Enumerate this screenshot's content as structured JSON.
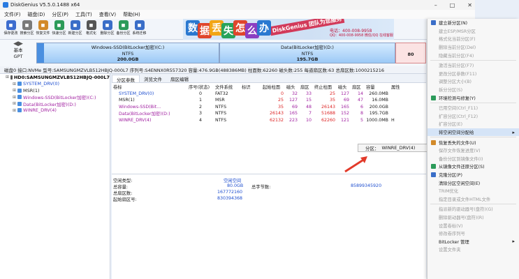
{
  "window": {
    "title": "DiskGenius V5.5.0.1488 x64"
  },
  "menu": [
    "文件(F)",
    "磁盘(D)",
    "分区(P)",
    "工具(T)",
    "查看(V)",
    "帮助(H)"
  ],
  "toolbar": [
    {
      "label": "保存更改",
      "icon": "save-icon",
      "color": "#3c6ccf"
    },
    {
      "label": "搜索分区",
      "icon": "search-icon",
      "color": "#7a7a7a"
    },
    {
      "label": "恢复文件",
      "icon": "recover-files-icon",
      "color": "#d28a2a"
    },
    {
      "label": "快速分区",
      "icon": "quick-partition-icon",
      "color": "#2c9b5a"
    },
    {
      "label": "新建分区",
      "icon": "new-partition-icon",
      "color": "#3a6ec8"
    },
    {
      "label": "格式化",
      "icon": "format-icon",
      "color": "#555555"
    },
    {
      "label": "删除分区",
      "icon": "delete-partition-icon",
      "color": "#3a6ec8"
    },
    {
      "label": "备份分区",
      "icon": "backup-partition-icon",
      "color": "#2c9b5a"
    },
    {
      "label": "系统迁移",
      "icon": "system-migrate-icon",
      "color": "#3a6ec8"
    }
  ],
  "banner": {
    "chars": [
      "数",
      "据",
      "丢",
      "失",
      "怎",
      "么",
      "办"
    ],
    "char_colors": [
      "#2a78d0",
      "#e0452c",
      "#f2a515",
      "#27a35b",
      "#e0452c",
      "#8b3ec2",
      "#2a78d0"
    ],
    "slogan": "DiskGenius 团队为您服务",
    "phone": "电话：400-008-9958",
    "qq": "QQ：400-008-9958 微信/QQ 在线客服"
  },
  "disk": {
    "type": "基本",
    "style": "GPT",
    "parts": [
      {
        "name": "Windows-SSD(BitLocker加密)(C:)",
        "fs": "NTFS",
        "size": "200.0GB"
      },
      {
        "name": "Data(BitLocker加密)(D:)",
        "fs": "NTFS",
        "size": "195.7GB"
      },
      {
        "name": "",
        "fs": "",
        "size": "80"
      }
    ]
  },
  "status_line": "磁盘0 接口:NVMe 型号:SAMSUNGMZVLB512HBJQ-000L7 序列号:S4ENNX0R557320 容量:476.9GB(488386MB) 柱面数:62260 磁头数:255 每道扇区数:63 总扇区数:1000215216",
  "tree": [
    {
      "label": "HD0:SAMSUNGMZVLB512HBJQ-000L7",
      "color": "#000",
      "selected": false,
      "icon": "disk-icon"
    },
    {
      "label": "SYSTEM_DRV(0)",
      "color": "#1e4ecf",
      "selected": false,
      "icon": "partition-icon"
    },
    {
      "label": "MSR(1)",
      "color": "#1a1a1a",
      "selected": false,
      "icon": "partition-icon"
    },
    {
      "label": "Windows-SSD(BitLocker加密)(C:)",
      "color": "#a01fa0",
      "selected": false,
      "icon": "partition-icon"
    },
    {
      "label": "Data(BitLocker加密)(D:)",
      "color": "#a01fa0",
      "selected": false,
      "icon": "partition-icon"
    },
    {
      "label": "WINRE_DRV(4)",
      "color": "#a01fa0",
      "selected": false,
      "icon": "partition-icon"
    }
  ],
  "tabs": [
    "分区参数",
    "浏览文件",
    "扇区编辑"
  ],
  "table": {
    "headers": [
      "卷标",
      "序号(状态)",
      "文件系统",
      "标识",
      "起始柱面",
      "磁头",
      "扇区",
      "终止柱面",
      "磁头",
      "扇区",
      "容量",
      "属性"
    ],
    "rows": [
      {
        "cells": [
          "SYSTEM_DRV(0)",
          "0",
          "FAT32",
          "",
          "0",
          "32",
          "33",
          "25",
          "127",
          "14",
          "260.0MB",
          ""
        ],
        "color": "#1e4ecf"
      },
      {
        "cells": [
          "MSR(1)",
          "1",
          "MSR",
          "",
          "25",
          "127",
          "15",
          "35",
          "69",
          "47",
          "16.0MB",
          ""
        ],
        "color": "#1a1a1a"
      },
      {
        "cells": [
          "Windows-SSD(Bit...",
          "2",
          "NTFS",
          "",
          "35",
          "69",
          "48",
          "26143",
          "165",
          "6",
          "200.0GB",
          ""
        ],
        "color": "#a01fa0"
      },
      {
        "cells": [
          "Data(BitLocker加密)(D:)",
          "3",
          "NTFS",
          "",
          "26143",
          "165",
          "7",
          "51688",
          "152",
          "8",
          "195.7GB",
          ""
        ],
        "color": "#a01fa0"
      },
      {
        "cells": [
          "WINRE_DRV(4)",
          "4",
          "NTFS",
          "",
          "62132",
          "223",
          "10",
          "62260",
          "121",
          "5",
          "1000.0MB",
          "H"
        ],
        "color": "#a01fa0"
      }
    ]
  },
  "free": {
    "type_label": "空闲类型:",
    "type_value": "空闲空间",
    "total_label": "总容量:",
    "total_value": "80.0GB",
    "total_bytes_label": "总字节数:",
    "total_bytes_value": "85899345920",
    "sectors_label": "总扇区数:",
    "sectors_value": "167772160",
    "start_label": "起始扇区号:",
    "start_value": "830394368"
  },
  "callout": {
    "label": "分区：",
    "value": "WINRE_DRV(4)"
  },
  "context_menu": [
    {
      "label": "建立新分区(N)",
      "disabled": false,
      "icon": "#3a6ec8",
      "highlight": false,
      "sub": false
    },
    {
      "label": "建立ESP/MSR分区",
      "disabled": true,
      "icon": "",
      "highlight": false,
      "sub": false
    },
    {
      "label": "格式化当前分区(F)",
      "disabled": true,
      "icon": "",
      "highlight": false,
      "sub": false
    },
    {
      "label": "删除当前分区(Del)",
      "disabled": true,
      "icon": "",
      "highlight": false,
      "sub": false
    },
    {
      "label": "隐藏当前分区(F4)",
      "disabled": true,
      "icon": "",
      "highlight": false,
      "sub": false
    },
    {
      "label": "",
      "divider": true
    },
    {
      "label": "激活当前分区(F7)",
      "disabled": true,
      "icon": "",
      "highlight": false,
      "sub": false
    },
    {
      "label": "更改分区参数(F11)",
      "disabled": true,
      "icon": "",
      "highlight": false,
      "sub": false
    },
    {
      "label": "调整分区大小(B)",
      "disabled": true,
      "icon": "",
      "highlight": false,
      "sub": false
    },
    {
      "label": "拆分分区(S)",
      "disabled": true,
      "icon": "",
      "highlight": false,
      "sub": false
    },
    {
      "label": "环境检测与修复(Y)",
      "disabled": false,
      "icon": "#2c9b5a",
      "highlight": false,
      "sub": false
    },
    {
      "label": "",
      "divider": true
    },
    {
      "label": "已用空间(Ctrl_F11)",
      "disabled": true,
      "icon": "",
      "highlight": false,
      "sub": false
    },
    {
      "label": "扩容分区(Ctrl_F12)",
      "disabled": true,
      "icon": "",
      "highlight": false,
      "sub": false
    },
    {
      "label": "扩容分区(E)",
      "disabled": true,
      "icon": "",
      "highlight": false,
      "sub": false
    },
    {
      "label": "将空闲空间分配给",
      "disabled": false,
      "icon": "",
      "highlight": true,
      "sub": true
    },
    {
      "label": "",
      "divider": true
    },
    {
      "label": "恢复丢失的文件(U)",
      "disabled": false,
      "icon": "#d28a2a",
      "highlight": false,
      "sub": false
    },
    {
      "label": "保存文件恢复进度(V)",
      "disabled": true,
      "icon": "",
      "highlight": false,
      "sub": false
    },
    {
      "label": "备份分区到镜像文件(I)",
      "disabled": true,
      "icon": "",
      "highlight": false,
      "sub": false
    },
    {
      "label": "从镜像文件还原分区(S)",
      "disabled": false,
      "icon": "#2c9b5a",
      "highlight": false,
      "sub": false
    },
    {
      "label": "克隆分区(P)",
      "disabled": false,
      "icon": "#3a6ec8",
      "highlight": false,
      "sub": false
    },
    {
      "label": "清除分区空闲空间(E)",
      "disabled": false,
      "icon": "",
      "highlight": false,
      "sub": false
    },
    {
      "label": "TRIM优化",
      "disabled": true,
      "icon": "",
      "highlight": false,
      "sub": false
    },
    {
      "label": "指定目录或文件HTML文件",
      "disabled": true,
      "icon": "",
      "highlight": false,
      "sub": false
    },
    {
      "label": "",
      "divider": true
    },
    {
      "label": "指派新的驱动器号(盘符)(G)",
      "disabled": true,
      "icon": "",
      "highlight": false,
      "sub": false
    },
    {
      "label": "删除驱动器号(盘符)(R)",
      "disabled": true,
      "icon": "",
      "highlight": false,
      "sub": false
    },
    {
      "label": "设置卷标(V)",
      "disabled": true,
      "icon": "",
      "highlight": false,
      "sub": false
    },
    {
      "label": "修改卷序列号",
      "disabled": true,
      "icon": "",
      "highlight": false,
      "sub": false
    },
    {
      "label": "BitLocker 管理",
      "disabled": false,
      "icon": "",
      "highlight": false,
      "sub": true
    },
    {
      "label": "设置文件夹",
      "disabled": true,
      "icon": "",
      "highlight": false,
      "sub": false
    }
  ]
}
